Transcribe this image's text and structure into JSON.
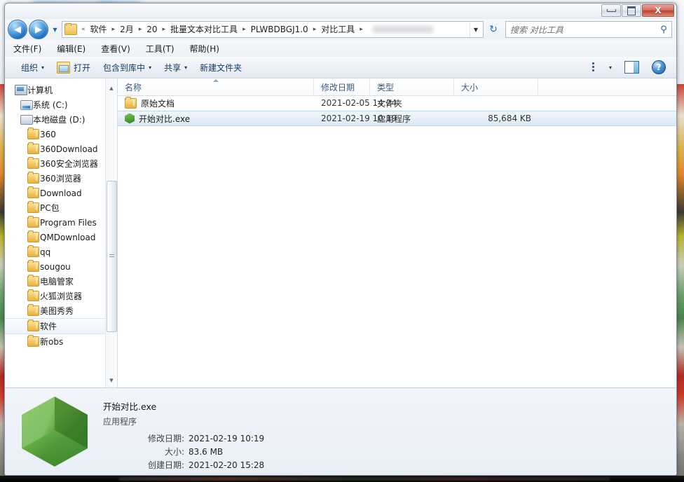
{
  "window": {
    "controls": {
      "minimize_label": "最小化",
      "maximize_label": "最大化",
      "close_label": "X"
    }
  },
  "address_bar": {
    "back_label": "◀",
    "forward_label": "▶",
    "history_caret": "▼",
    "folder_icon": "folder-icon",
    "leading_chevron": "«",
    "crumbs": [
      "软件",
      "2月",
      "20",
      "批量文本对比工具",
      "PLWBDBGJ1.0",
      "对比工具"
    ],
    "crumb_separator": "▸",
    "dropdown_caret": "▼",
    "refresh_label": "↻"
  },
  "search": {
    "placeholder": "搜索 对比工具",
    "value": "",
    "icon": "search-icon"
  },
  "menu": {
    "items": [
      "文件(F)",
      "编辑(E)",
      "查看(V)",
      "工具(T)",
      "帮助(H)"
    ]
  },
  "toolbar": {
    "organize_label": "组织",
    "open_label": "打开",
    "include_library_label": "包含到库中",
    "share_label": "共享",
    "new_folder_label": "新建文件夹",
    "caret": "▾",
    "view_icon": "list-view-icon",
    "view_caret": "▾",
    "preview_pane_icon": "preview-pane-icon",
    "help_icon": "?"
  },
  "sidebar": {
    "items": [
      {
        "label": "计算机",
        "icon": "computer-icon",
        "level": 0,
        "selected": false
      },
      {
        "label": "系统 (C:)",
        "icon": "system-drive-icon",
        "level": 1,
        "selected": false
      },
      {
        "label": "本地磁盘 (D:)",
        "icon": "disk-icon",
        "level": 1,
        "selected": false
      },
      {
        "label": "360",
        "icon": "folder-icon",
        "level": 2,
        "selected": false
      },
      {
        "label": "360Download",
        "icon": "folder-icon",
        "level": 2,
        "selected": false
      },
      {
        "label": "360安全浏览器",
        "icon": "folder-icon",
        "level": 2,
        "selected": false
      },
      {
        "label": "360浏览器",
        "icon": "folder-icon",
        "level": 2,
        "selected": false
      },
      {
        "label": "Download",
        "icon": "folder-icon",
        "level": 2,
        "selected": false
      },
      {
        "label": "PC包",
        "icon": "folder-icon",
        "level": 2,
        "selected": false
      },
      {
        "label": "Program Files",
        "icon": "folder-icon",
        "level": 2,
        "selected": false
      },
      {
        "label": "QMDownload",
        "icon": "folder-icon",
        "level": 2,
        "selected": false
      },
      {
        "label": "qq",
        "icon": "folder-icon",
        "level": 2,
        "selected": false
      },
      {
        "label": "sougou",
        "icon": "folder-icon",
        "level": 2,
        "selected": false
      },
      {
        "label": "电脑管家",
        "icon": "folder-icon",
        "level": 2,
        "selected": false
      },
      {
        "label": "火狐浏览器",
        "icon": "folder-icon",
        "level": 2,
        "selected": false
      },
      {
        "label": "美图秀秀",
        "icon": "folder-icon",
        "level": 2,
        "selected": false
      },
      {
        "label": "软件",
        "icon": "folder-icon",
        "level": 2,
        "selected": true
      },
      {
        "label": "新obs",
        "icon": "folder-icon",
        "level": 2,
        "selected": false
      }
    ],
    "scroll_up_label": "▲",
    "scroll_down_label": "▼"
  },
  "file_list": {
    "columns": [
      {
        "label": "名称",
        "sorted": true
      },
      {
        "label": "修改日期",
        "sorted": false
      },
      {
        "label": "类型",
        "sorted": false
      },
      {
        "label": "大小",
        "sorted": false
      }
    ],
    "rows": [
      {
        "name": "原始文档",
        "icon": "folder-icon",
        "modified": "2021-02-05 14:24",
        "type": "文件夹",
        "size": "",
        "selected": false
      },
      {
        "name": "开始对比.exe",
        "icon": "green-hexagon-app-icon",
        "modified": "2021-02-19 10:19",
        "type": "应用程序",
        "size": "85,684 KB",
        "selected": true
      }
    ]
  },
  "details_pane": {
    "icon": "green-hexagon-app-icon",
    "title": "开始对比.exe",
    "subtitle": "应用程序",
    "fields": [
      {
        "label": "修改日期:",
        "value": "2021-02-19 10:19"
      },
      {
        "label": "大小:",
        "value": "83.6 MB"
      },
      {
        "label": "创建日期:",
        "value": "2021-02-20 15:28"
      }
    ]
  },
  "colors": {
    "selection_blue": "#dce9f5",
    "accent_blue": "#1d6fc0",
    "app_icon_green": "#5fae3c",
    "close_red": "#bc4030"
  }
}
